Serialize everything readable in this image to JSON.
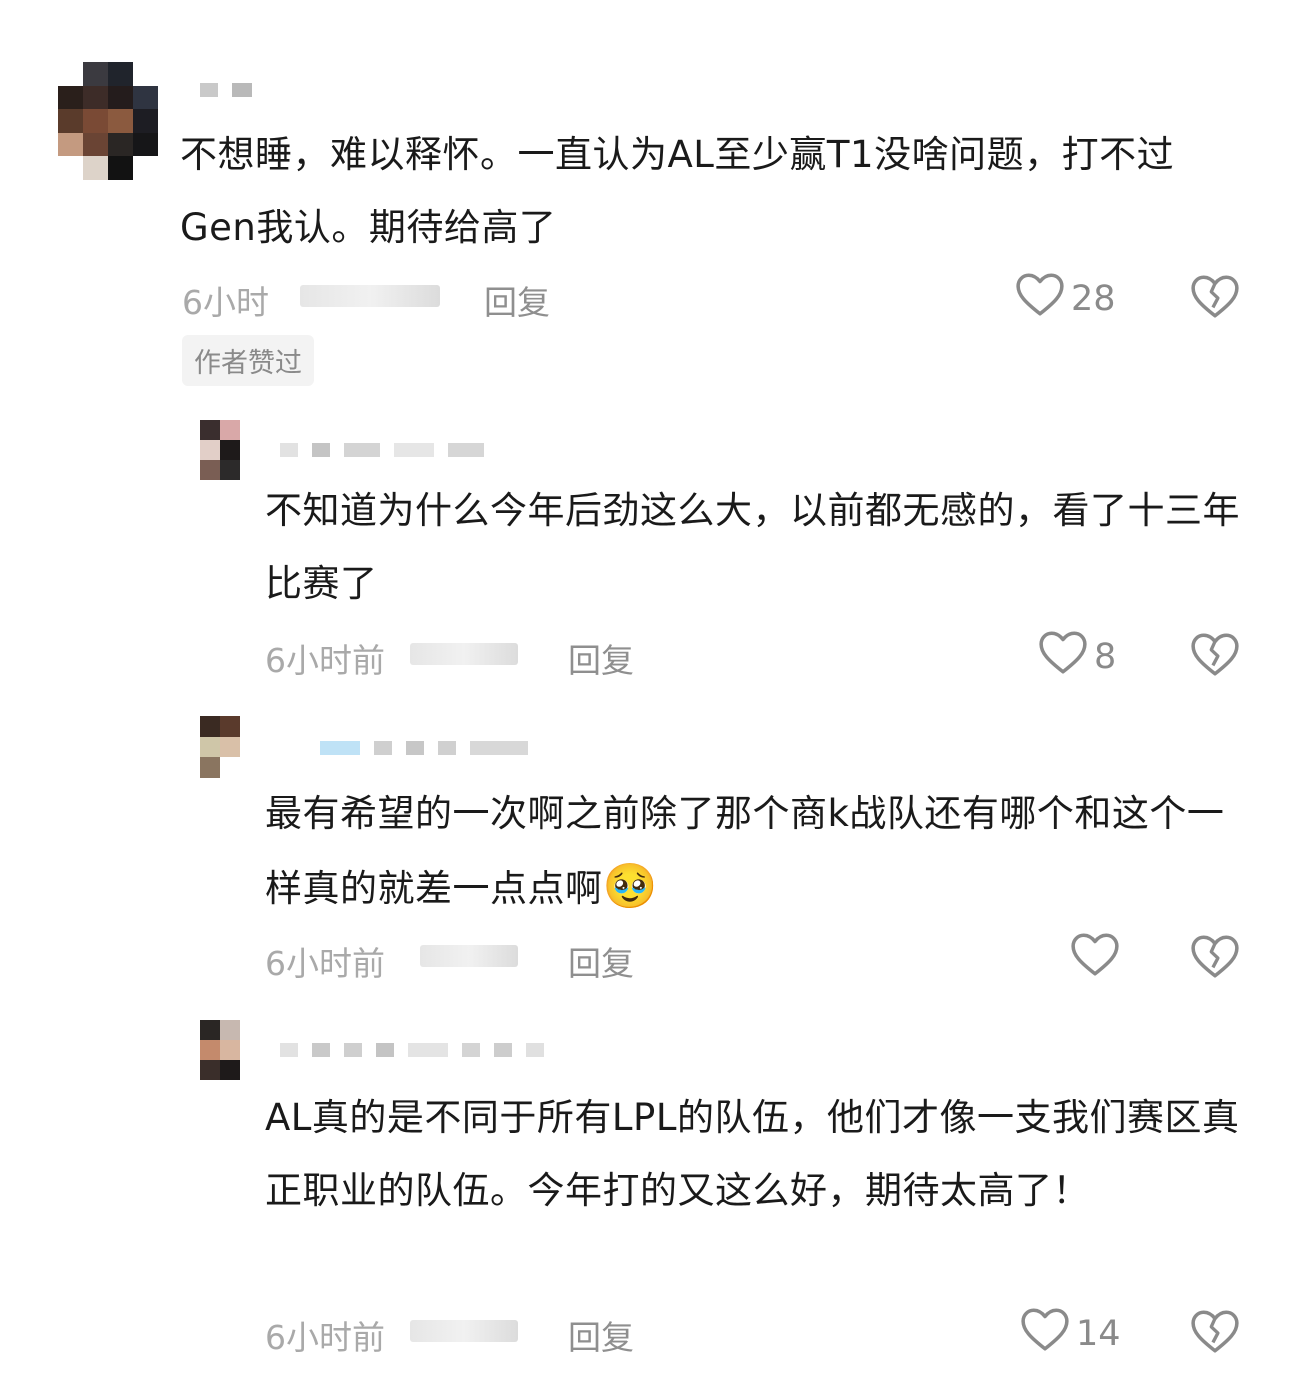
{
  "comments": [
    {
      "text": "不想睡，难以释怀。一直认为AL至少赢T1没啥问题，打不过Gen我认。期待给高了",
      "time": "6小时",
      "reply_label": "回复",
      "like_count": "28",
      "badge": "作者赞过"
    },
    {
      "text": "不知道为什么今年后劲这么大，以前都无感的，看了十三年比赛了",
      "time": "6小时前",
      "reply_label": "回复",
      "like_count": "8"
    },
    {
      "text": "最有希望的一次啊之前除了那个商k战队还有哪个和这个一样真的就差一点点啊",
      "emoji": "🥹",
      "time": "6小时前",
      "reply_label": "回复",
      "like_count": ""
    },
    {
      "text": "AL真的是不同于所有LPL的队伍，他们才像一支我们赛区真正职业的队伍。今年打的又这么好，期待太高了！",
      "time": "6小时前",
      "reply_label": "回复",
      "like_count": "14"
    }
  ],
  "icons": {
    "like": "heart-outline-icon",
    "dislike": "broken-heart-icon"
  },
  "colors": {
    "text": "#1a1a1a",
    "meta": "#a9a9a9",
    "icon": "#8a8a8a"
  }
}
